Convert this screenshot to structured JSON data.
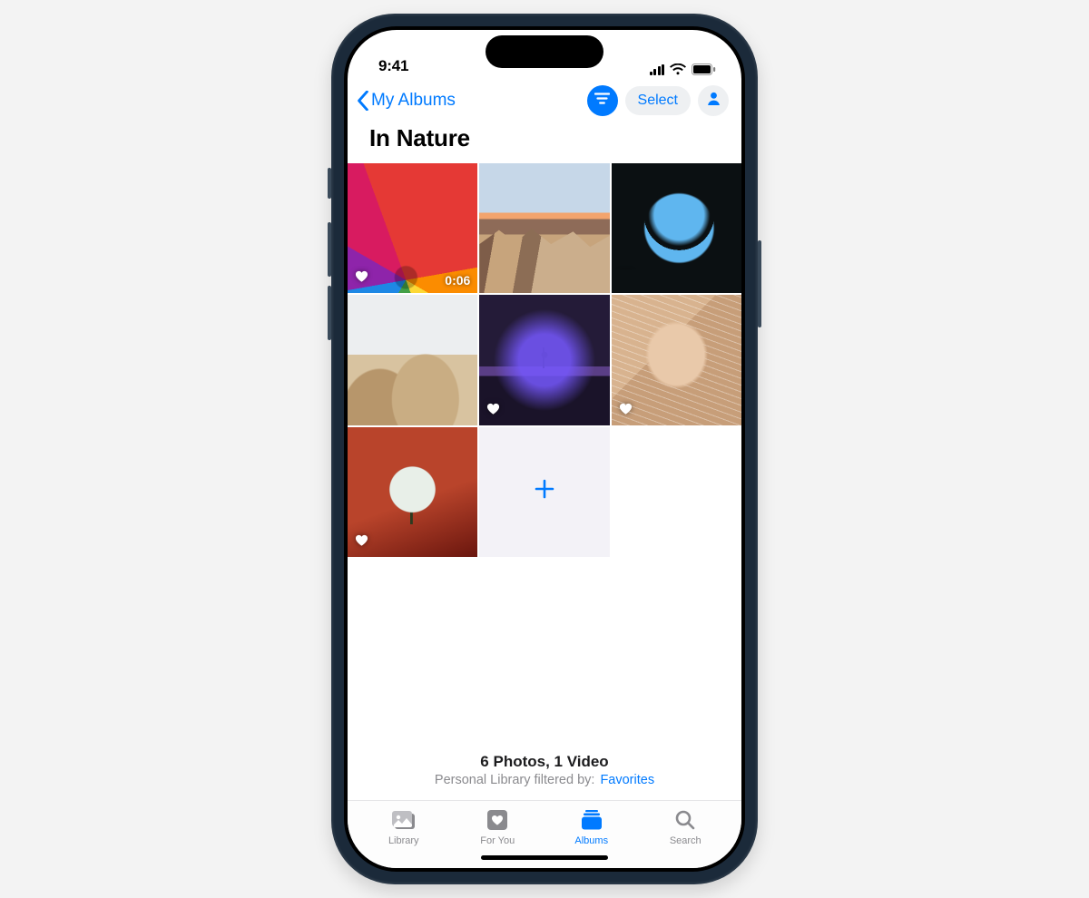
{
  "status": {
    "time": "9:41"
  },
  "nav": {
    "back_label": "My Albums",
    "select_label": "Select"
  },
  "title": "In Nature",
  "grid": {
    "items": [
      {
        "favorite": true,
        "video_duration": "0:06"
      },
      {
        "favorite": true,
        "panorama": true
      },
      {
        "favorite": true
      },
      {
        "favorite": true
      },
      {
        "favorite": true
      },
      {
        "favorite": true
      },
      {
        "favorite": true
      }
    ]
  },
  "summary": {
    "count_text": "6 Photos, 1 Video",
    "filter_prefix": "Personal Library filtered by:",
    "filter_value": "Favorites"
  },
  "tabs": {
    "library": "Library",
    "for_you": "For You",
    "albums": "Albums",
    "search": "Search"
  }
}
